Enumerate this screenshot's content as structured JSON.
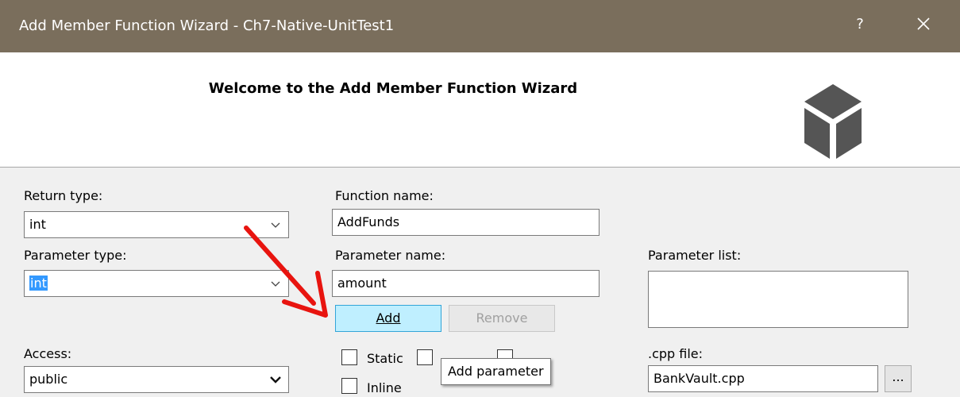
{
  "window": {
    "title": "Add Member Function Wizard - Ch7-Native-UnitTest1",
    "help_label": "?"
  },
  "banner": {
    "heading": "Welcome to the Add Member Function Wizard"
  },
  "form": {
    "return_type": {
      "label": "Return type:",
      "value": "int"
    },
    "function_name": {
      "label": "Function name:",
      "value": "AddFunds"
    },
    "parameter_type": {
      "label": "Parameter type:",
      "value": "int"
    },
    "parameter_name": {
      "label": "Parameter name:",
      "value": "amount"
    },
    "parameter_list": {
      "label": "Parameter list:"
    },
    "add_button": "Add",
    "remove_button": "Remove",
    "access": {
      "label": "Access:",
      "value": "public"
    },
    "static_label": "Static",
    "inline_label": "Inline",
    "cpp_file": {
      "label": ".cpp file:",
      "value": "BankVault.cpp"
    },
    "browse_button": "..."
  },
  "tooltip": {
    "text": "Add parameter"
  },
  "colors": {
    "titlebar": "#7a6e5c",
    "add_button_bg": "#bfefff",
    "selection": "#3399ff",
    "annotation_arrow": "#e8140f"
  },
  "icons": {
    "close": "close-icon",
    "logo": "cube-logo-icon",
    "dropdown": "chevron-down-icon"
  }
}
